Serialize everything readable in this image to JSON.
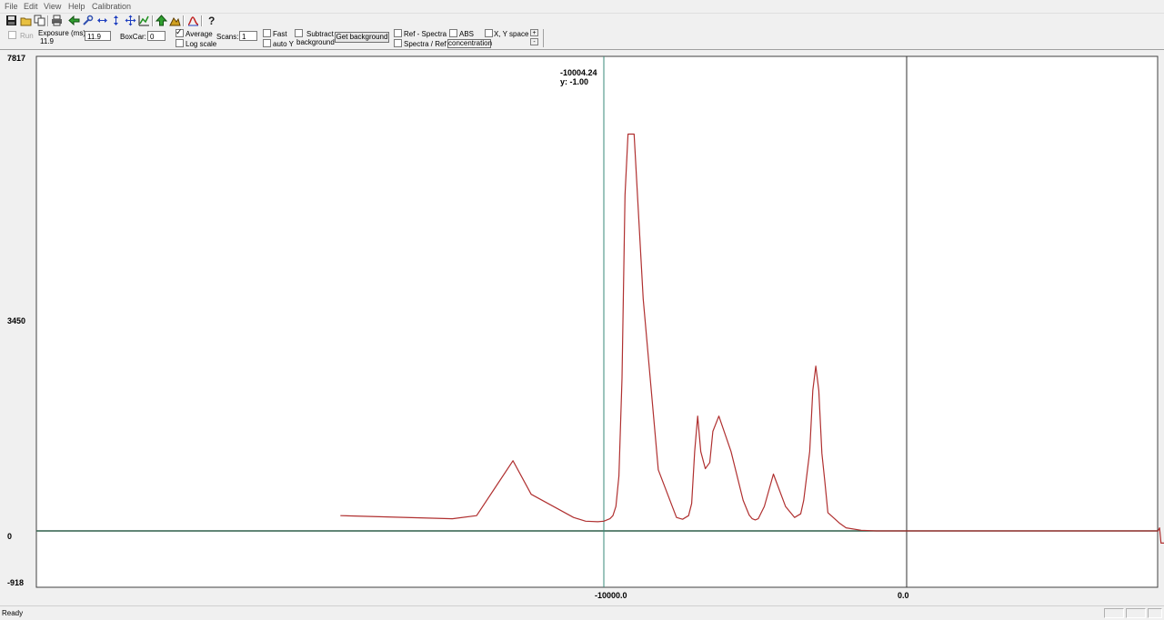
{
  "menu": [
    "File",
    "Edit",
    "View",
    "Help",
    "Calibration"
  ],
  "toolbar_icons": [
    "save-icon",
    "open-icon",
    "copy-icon",
    "print-icon",
    "back-icon",
    "wrench-icon",
    "horizontal-arrows-icon",
    "vertical-arrows-icon",
    "move-icon",
    "chart-icon",
    "up-arrow-icon",
    "mountain-icon",
    "spectrum-icon",
    "help-icon"
  ],
  "controls": {
    "run_label": "Run",
    "exposure_label": "Exposure (ms):",
    "exposure_readout": "11.9",
    "exposure_value": "11.9",
    "boxcar_label": "BoxCar:",
    "boxcar_value": "0",
    "average_label": "Average",
    "logscale_label": "Log scale",
    "scans_label": "Scans:",
    "scans_value": "1",
    "fast_label": "Fast",
    "autoy_label": "auto Y",
    "subtract_label1": "Subtract",
    "subtract_label2": "background",
    "get_background_label": "Get background",
    "ref_spectra_label": "Ref - Spectra",
    "spectra_ref_label": "Spectra / Ref",
    "abs_label": "ABS",
    "concentration_label": "concentration",
    "xy_space_label": "X, Y space",
    "spin_up": "+",
    "spin_down": "-"
  },
  "chart_data": {
    "type": "line",
    "y_ticks": [
      "7817",
      "3450",
      "0",
      "-918"
    ],
    "x_ticks": [
      "-10000.0",
      "0.0"
    ],
    "ylim": [
      -918,
      7817
    ],
    "cursor_readout": {
      "x": "-10004.24",
      "y": "y: -1.00"
    },
    "grid": false,
    "series": [
      {
        "color": "#b03030",
        "x": [
          -18700,
          -15000,
          -14200,
          -13600,
          -13000,
          -12400,
          -11000,
          -10600,
          -10200,
          -10000,
          -9800,
          -9700,
          -9600,
          -9500,
          -9400,
          -9300,
          -9200,
          -9000,
          -8700,
          -8200,
          -7600,
          -7400,
          -7200,
          -7100,
          -7000,
          -6900,
          -6800,
          -6650,
          -6500,
          -6400,
          -6200,
          -5800,
          -5400,
          -5200,
          -5100,
          -5000,
          -4900,
          -4700,
          -4400,
          -4000,
          -3700,
          -3500,
          -3400,
          -3300,
          -3200,
          -3100,
          -3000,
          -2900,
          -2800,
          -2700,
          -2600,
          -2200,
          -2000,
          -1500,
          -1000,
          0,
          1000,
          2000,
          3000,
          4000,
          5000,
          6000,
          7000,
          8000,
          8300,
          8350,
          8400,
          8500
        ],
        "y": [
          250,
          200,
          250,
          700,
          1150,
          600,
          220,
          160,
          150,
          160,
          200,
          250,
          400,
          900,
          2500,
          5500,
          6500,
          6500,
          3800,
          1000,
          220,
          190,
          250,
          450,
          1300,
          1880,
          1300,
          1020,
          1120,
          1630,
          1880,
          1300,
          500,
          260,
          200,
          180,
          200,
          400,
          930,
          400,
          220,
          280,
          500,
          900,
          1300,
          2300,
          2700,
          2300,
          1270,
          800,
          300,
          120,
          50,
          10,
          0,
          0,
          0,
          0,
          0,
          0,
          0,
          0,
          0,
          0,
          0,
          50,
          -200,
          -200
        ]
      }
    ]
  },
  "status": {
    "text": "Ready"
  }
}
